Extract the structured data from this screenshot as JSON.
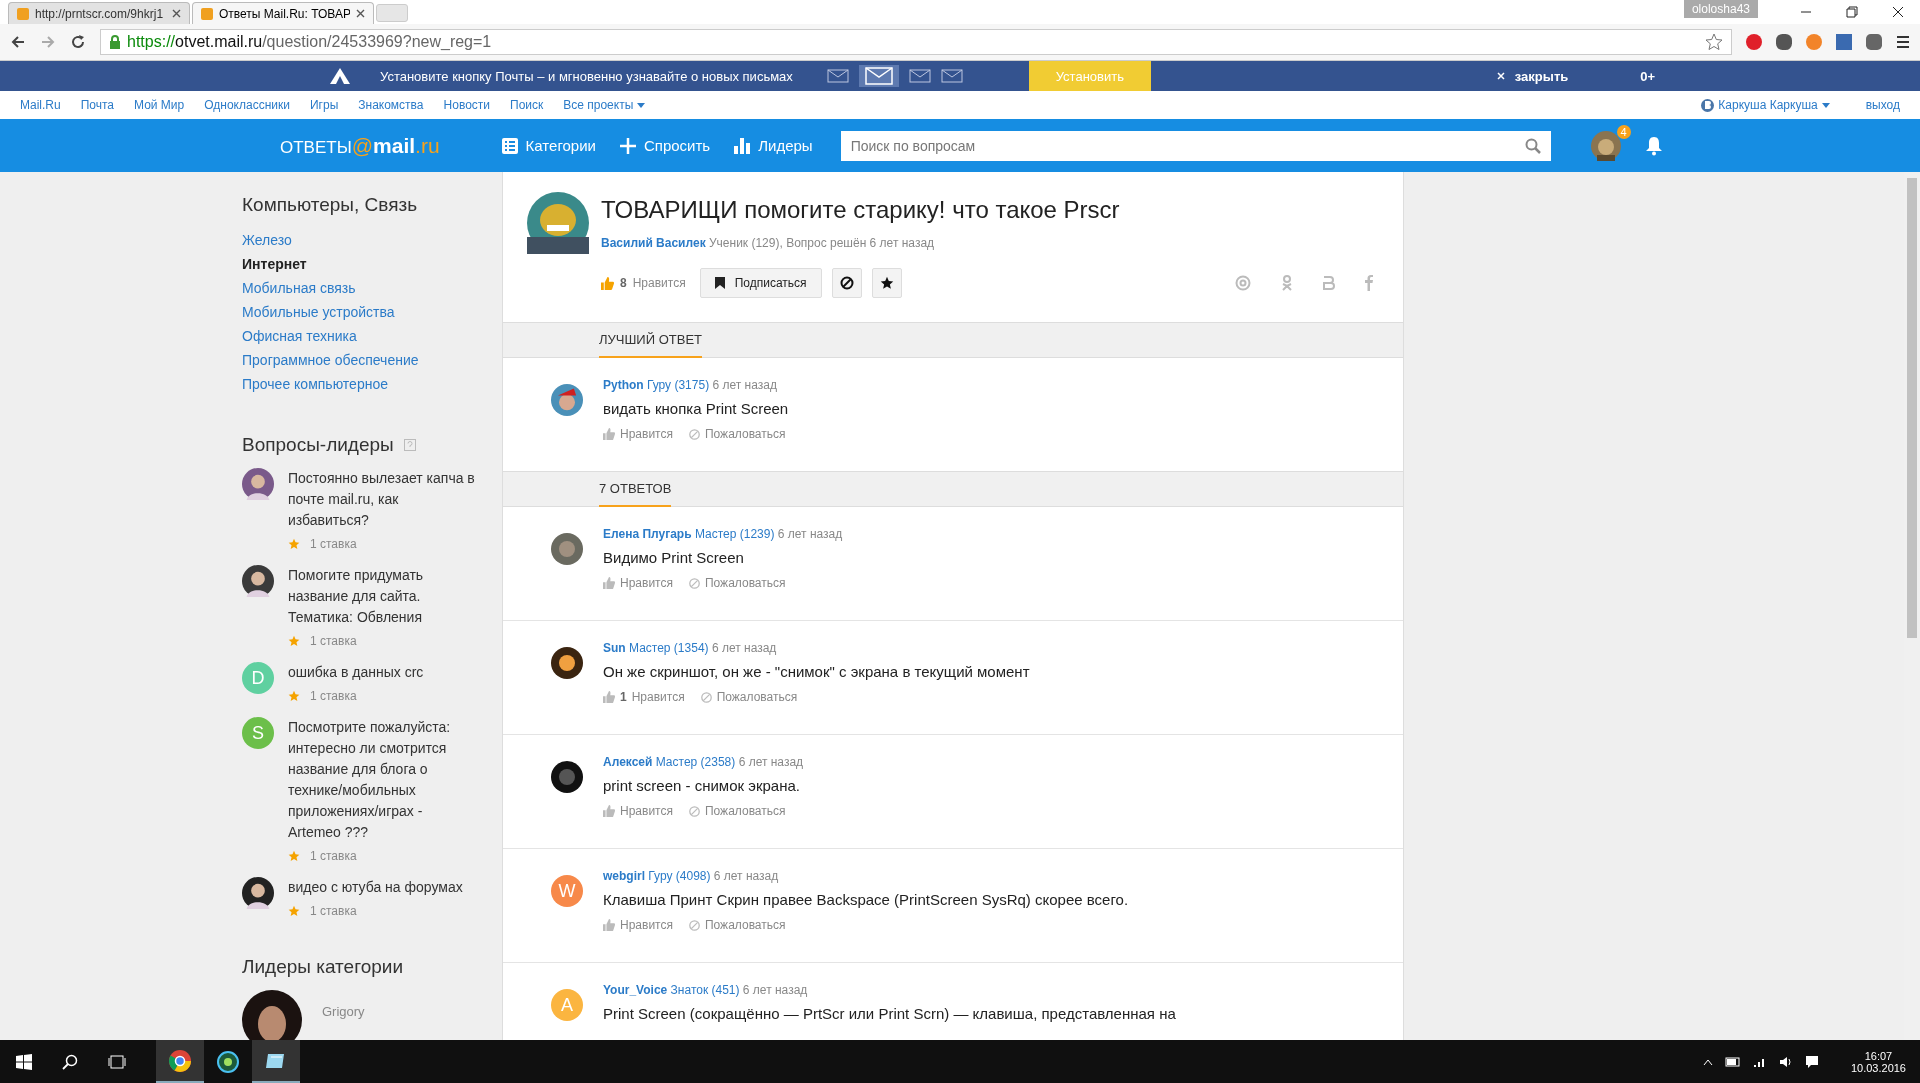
{
  "browser": {
    "tabs": [
      {
        "title": "http://prntscr.com/9hkrj1",
        "selected": false
      },
      {
        "title": "Ответы Mail.Ru: ТОВАР",
        "selected": true
      }
    ],
    "url_scheme": "https://",
    "url_host": "otvet.mail.ru",
    "url_path": "/question/24533969?new_reg=1",
    "profile": "ololosha43"
  },
  "promo": {
    "text": "Установите кнопку Почты – и мгновенно узнавайте о новых письмах",
    "install": "Установить",
    "close": "закрыть",
    "age": "0+"
  },
  "nav": {
    "links": [
      "Mail.Ru",
      "Почта",
      "Мой Мир",
      "Одноклассники",
      "Игры",
      "Знакомства",
      "Новости",
      "Поиск"
    ],
    "more": "Все проекты",
    "user": "Каркуша Каркуша",
    "logout": "выход"
  },
  "header": {
    "logo_parts": [
      "ОТВЕТЫ",
      "@",
      "mail",
      ".ru"
    ],
    "menu": [
      "Категории",
      "Спросить",
      "Лидеры"
    ],
    "search": {
      "placeholder": "Поиск по вопросам"
    },
    "badge": "4"
  },
  "sidebar": {
    "category_title": "Компьютеры, Связь",
    "categories": [
      {
        "label": "Железо",
        "selected": false
      },
      {
        "label": "Интернет",
        "selected": true
      },
      {
        "label": "Мобильная связь",
        "selected": false
      },
      {
        "label": "Мобильные устройства",
        "selected": false
      },
      {
        "label": "Офисная техника",
        "selected": false
      },
      {
        "label": "Программное обеспечение",
        "selected": false
      },
      {
        "label": "Прочее компьютерное",
        "selected": false
      }
    ],
    "leaders_title": "Вопросы-лидеры",
    "questions": [
      {
        "text": "Постоянно вылезает капча в почте mail.ru, как избавиться?",
        "bets": "1 ставка"
      },
      {
        "text": "Помогите придумать название для сайта. Тематика: Обвления",
        "bets": "1 ставка"
      },
      {
        "avatar": {
          "kind": "letter",
          "letter": "D",
          "color": "#5fd0a0"
        },
        "text": "ошибка в данных crc",
        "bets": "1 ставка"
      },
      {
        "avatar": {
          "kind": "letter",
          "letter": "S",
          "color": "#6cbf4a"
        },
        "text": "Посмотрите пожалуйста: интересно ли смотрится название для блога о технике/мобильных приложениях/играх - Artemeo ???",
        "bets": "1 ставка"
      },
      {
        "text": "видео с ютуба на форумах",
        "bets": "1 ставка"
      }
    ],
    "category_leaders_title": "Лидеры категории",
    "leader_name": "Grigory"
  },
  "question": {
    "title": "ТОВАРИЩИ помогите старику! что такое Prscr",
    "author": "Василий Василек",
    "meta": "Ученик (129), Вопрос решён 6 лет назад",
    "likes": "8",
    "like_label": "Нравится",
    "subscribe": "Подписаться"
  },
  "best_answer": {
    "title": "ЛУЧШИЙ ОТВЕТ",
    "answer": {
      "name": "Python",
      "rank": "Гуру (3175)",
      "time": "6 лет назад",
      "text": "видать кнопка Print Screen",
      "like_label": "Нравится",
      "complain": "Пожаловаться"
    }
  },
  "answers_title": "7 ОТВЕТОВ",
  "answers": [
    {
      "name": "Елена Плугарь",
      "rank": "Мастер (1239)",
      "time": "6 лет назад",
      "text": "Видимо Print Screen",
      "like_label": "Нравится",
      "complain": "Пожаловаться"
    },
    {
      "name": "Sun",
      "rank": "Мастер (1354)",
      "time": "6 лет назад",
      "text": "Он же скриншот, он же - \"снимок\" с экрана в текущий момент",
      "likes": "1",
      "like_label": "Нравится",
      "complain": "Пожаловаться"
    },
    {
      "name": "Алексей",
      "rank": "Мастер (2358)",
      "time": "6 лет назад",
      "text": "print screen - снимок экрана.",
      "like_label": "Нравится",
      "complain": "Пожаловаться"
    },
    {
      "avatar": {
        "kind": "letter",
        "letter": "W",
        "color": "#f7894a"
      },
      "name": "webgirl",
      "rank": "Гуру (4098)",
      "time": "6 лет назад",
      "text": "Клавиша Принт Скрин правее Backspace (PrintScreen SysRq) скорее всего.",
      "like_label": "Нравится",
      "complain": "Пожаловаться"
    },
    {
      "avatar": {
        "kind": "letter",
        "letter": "A",
        "color": "#fbb540"
      },
      "name": "Your_Voice",
      "rank": "Знаток (451)",
      "time": "6 лет назад",
      "text": "Print Screen (сокращённо — PrtScr или Print Scrn) — клавиша, представленная на"
    }
  ],
  "taskbar": {
    "time": "16:07",
    "date": "10.03.2016"
  }
}
